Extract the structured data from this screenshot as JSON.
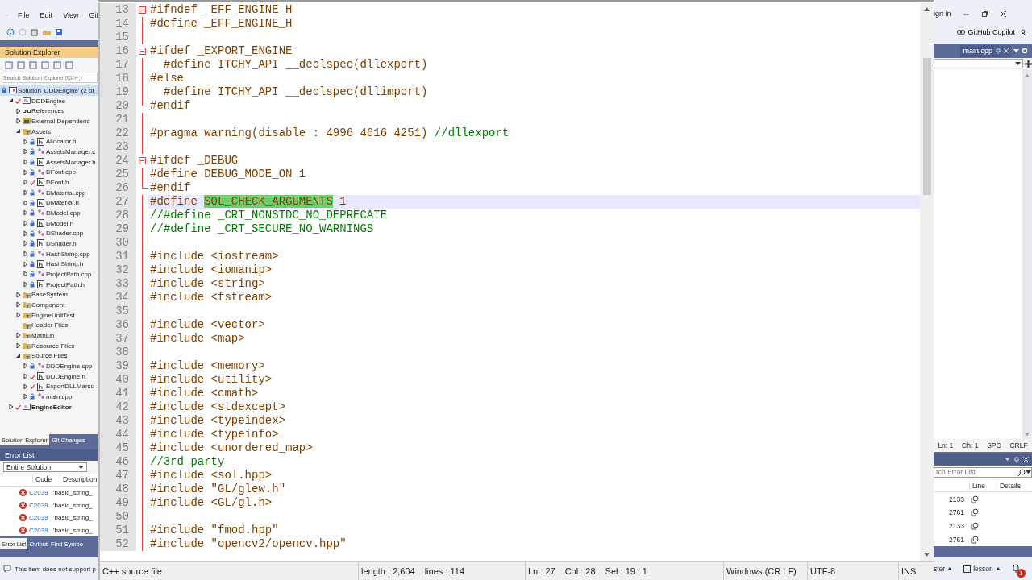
{
  "vs_menu": [
    "File",
    "Edit",
    "View",
    "Git"
  ],
  "vs_titlebar": {
    "sign_in": "ign in",
    "copilot": "GitHub Copilot"
  },
  "solution_explorer": {
    "title": "Solution Explorer",
    "search_placeholder": "Search Solution Explorer (Ctrl+;)",
    "tree": [
      {
        "label": "Solution 'DDDEngine' (2 of",
        "kind": "solution",
        "modified": false,
        "selected": true,
        "children": [
          {
            "label": "DDDEngine",
            "kind": "project",
            "modified": true,
            "expanded": true,
            "selected": false,
            "children": [
              {
                "label": "References",
                "kind": "references",
                "expanded": false,
                "selected": false
              },
              {
                "label": "External Dependenc",
                "kind": "dependencies",
                "expanded": false,
                "selected": false
              },
              {
                "label": "Assets",
                "kind": "folder",
                "expanded": true,
                "selected": false,
                "children": [
                  {
                    "label": "Allocator.h",
                    "kind": "header",
                    "modified": false,
                    "expanded": false,
                    "selected": false
                  },
                  {
                    "label": "AssetsManager.c",
                    "kind": "source",
                    "modified": false,
                    "expanded": false,
                    "selected": false
                  },
                  {
                    "label": "AssetsManager.h",
                    "kind": "header",
                    "modified": false,
                    "expanded": false,
                    "selected": false
                  },
                  {
                    "label": "DFont.cpp",
                    "kind": "source",
                    "modified": false,
                    "expanded": false,
                    "selected": false
                  },
                  {
                    "label": "DFont.h",
                    "kind": "header",
                    "modified": true,
                    "expanded": false,
                    "selected": false
                  },
                  {
                    "label": "DMaterial.cpp",
                    "kind": "source",
                    "modified": false,
                    "expanded": false,
                    "selected": false
                  },
                  {
                    "label": "DMaterial.h",
                    "kind": "header",
                    "modified": false,
                    "expanded": false,
                    "selected": false
                  },
                  {
                    "label": "DModel.cpp",
                    "kind": "source",
                    "modified": false,
                    "expanded": false,
                    "selected": false
                  },
                  {
                    "label": "DModel.h",
                    "kind": "header",
                    "modified": false,
                    "expanded": false,
                    "selected": false
                  },
                  {
                    "label": "DShader.cpp",
                    "kind": "source",
                    "modified": false,
                    "expanded": false,
                    "selected": false
                  },
                  {
                    "label": "DShader.h",
                    "kind": "header",
                    "modified": false,
                    "expanded": false,
                    "selected": false
                  },
                  {
                    "label": "HashString.cpp",
                    "kind": "source",
                    "modified": false,
                    "expanded": false,
                    "selected": false
                  },
                  {
                    "label": "HashString.h",
                    "kind": "header",
                    "modified": false,
                    "expanded": false,
                    "selected": false
                  },
                  {
                    "label": "ProjectPath.cpp",
                    "kind": "source",
                    "modified": false,
                    "expanded": false,
                    "selected": false
                  },
                  {
                    "label": "ProjectPath.h",
                    "kind": "header",
                    "modified": false,
                    "expanded": false,
                    "selected": false
                  }
                ]
              },
              {
                "label": "BaseSystem",
                "kind": "folder",
                "expanded": false,
                "selected": false
              },
              {
                "label": "Component",
                "kind": "folder",
                "expanded": false,
                "selected": false
              },
              {
                "label": "EngineUnitTest",
                "kind": "folder",
                "expanded": false,
                "selected": false
              },
              {
                "label": "Header Files",
                "kind": "folder",
                "selected": false
              },
              {
                "label": "MathLib",
                "kind": "folder",
                "expanded": false,
                "selected": false
              },
              {
                "label": "Resource Files",
                "kind": "folder",
                "expanded": false,
                "selected": false
              },
              {
                "label": "Source Files",
                "kind": "folder",
                "expanded": true,
                "selected": false,
                "children": [
                  {
                    "label": "DDDEngine.cpp",
                    "kind": "source",
                    "modified": false,
                    "expanded": false,
                    "selected": false
                  },
                  {
                    "label": "DDDEngine.h",
                    "kind": "header",
                    "modified": true,
                    "expanded": false,
                    "selected": false
                  },
                  {
                    "label": "ExportDLLMarco",
                    "kind": "header",
                    "modified": true,
                    "expanded": false,
                    "selected": false
                  },
                  {
                    "label": "main.cpp",
                    "kind": "source",
                    "modified": false,
                    "expanded": false,
                    "selected": false
                  }
                ]
              }
            ]
          },
          {
            "label": "EngineEditor",
            "kind": "project",
            "modified": true,
            "expanded": false,
            "selected": false
          }
        ]
      }
    ],
    "tabs": [
      {
        "label": "Solution Explorer",
        "selected": true
      },
      {
        "label": "Git Changes",
        "selected": false
      }
    ]
  },
  "document_tab": {
    "label": "main.cpp",
    "selected": true
  },
  "vs_editor_status": [
    "Ln: 1",
    "Ch: 1",
    "SPC",
    "CRLF"
  ],
  "error_list": {
    "title": "Error List",
    "scope": "Entire Solution",
    "search_placeholder": "rch Error List",
    "columns": [
      "Code",
      "Description",
      "Line",
      "Details"
    ],
    "rows": [
      {
        "code": "C2039",
        "description": "'basic_string_",
        "line": "2133"
      },
      {
        "code": "C2039",
        "description": "'basic_string_",
        "line": "2761"
      },
      {
        "code": "C2039",
        "description": "'basic_string_",
        "line": "2133"
      },
      {
        "code": "C2039",
        "description": "'basic_string_",
        "line": "2761"
      }
    ],
    "tabs": [
      {
        "label": "Error List",
        "selected": true
      },
      {
        "label": "Output",
        "selected": false
      },
      {
        "label": "Find Symbo",
        "selected": false
      }
    ]
  },
  "vs_status": {
    "message": "This item does not support p",
    "branch": "ster",
    "repository": "lesson",
    "notifications": "1"
  },
  "editor": {
    "lines": [
      {
        "number": "13",
        "kind": "start",
        "current": false,
        "parts": [
          {
            "text": "#ifndef _EFF_ENGINE_H",
            "kind": "pre"
          }
        ]
      },
      {
        "number": "14",
        "kind": "body",
        "current": false,
        "parts": [
          {
            "text": "#define _EFF_ENGINE_H",
            "kind": "pre"
          }
        ]
      },
      {
        "number": "15",
        "kind": "body",
        "current": false
      },
      {
        "number": "16",
        "kind": "start",
        "current": false,
        "parts": [
          {
            "text": "#ifdef _EXPORT_ENGINE",
            "kind": "pre"
          }
        ]
      },
      {
        "number": "17",
        "kind": "body",
        "current": false,
        "parts": [
          {
            "text": "  #define ITCHY_API __declspec(dllexport)",
            "kind": "pre"
          }
        ]
      },
      {
        "number": "18",
        "kind": "body",
        "current": false,
        "parts": [
          {
            "text": "#else",
            "kind": "pre"
          }
        ]
      },
      {
        "number": "19",
        "kind": "body",
        "current": false,
        "parts": [
          {
            "text": "  #define ITCHY_API __declspec(dllimport)",
            "kind": "pre"
          }
        ]
      },
      {
        "number": "20",
        "kind": "end",
        "current": false,
        "parts": [
          {
            "text": "#endif",
            "kind": "pre"
          }
        ]
      },
      {
        "number": "21",
        "kind": "body",
        "current": false
      },
      {
        "number": "22",
        "kind": "body",
        "current": false,
        "parts": [
          {
            "text": "#pragma warning(disable : 4996 4616 4251) ",
            "kind": "pre"
          },
          {
            "text": "//dllexport",
            "kind": "comment"
          }
        ]
      },
      {
        "number": "23",
        "kind": "body",
        "current": false
      },
      {
        "number": "24",
        "kind": "start",
        "current": false,
        "parts": [
          {
            "text": "#ifdef _DEBUG",
            "kind": "pre"
          }
        ]
      },
      {
        "number": "25",
        "kind": "body",
        "current": false,
        "parts": [
          {
            "text": "#define DEBUG_MODE_ON 1",
            "kind": "pre"
          }
        ]
      },
      {
        "number": "26",
        "kind": "end",
        "current": false,
        "parts": [
          {
            "text": "#endif",
            "kind": "pre"
          }
        ]
      },
      {
        "number": "27",
        "kind": "body",
        "current": true,
        "parts": [
          {
            "text": "#define ",
            "kind": "pre"
          },
          {
            "text": "SOL_CHECK_ARGUMENTS",
            "kind": "match"
          },
          {
            "text": " 1",
            "kind": "pre"
          }
        ]
      },
      {
        "number": "28",
        "kind": "body",
        "current": false,
        "parts": [
          {
            "text": "//#define _CRT_NONSTDC_NO_DEPRECATE",
            "kind": "comment"
          }
        ]
      },
      {
        "number": "29",
        "kind": "body",
        "current": false,
        "parts": [
          {
            "text": "//#define _CRT_SECURE_NO_WARNINGS",
            "kind": "comment"
          }
        ]
      },
      {
        "number": "30",
        "kind": "body",
        "current": false
      },
      {
        "number": "31",
        "kind": "body",
        "current": false,
        "parts": [
          {
            "text": "#include <iostream>",
            "kind": "pre"
          }
        ]
      },
      {
        "number": "32",
        "kind": "body",
        "current": false,
        "parts": [
          {
            "text": "#include <iomanip>",
            "kind": "pre"
          }
        ]
      },
      {
        "number": "33",
        "kind": "body",
        "current": false,
        "parts": [
          {
            "text": "#include <string>",
            "kind": "pre"
          }
        ]
      },
      {
        "number": "34",
        "kind": "body",
        "current": false,
        "parts": [
          {
            "text": "#include <fstream>",
            "kind": "pre"
          }
        ]
      },
      {
        "number": "35",
        "kind": "body",
        "current": false
      },
      {
        "number": "36",
        "kind": "body",
        "current": false,
        "parts": [
          {
            "text": "#include <vector>",
            "kind": "pre"
          }
        ]
      },
      {
        "number": "37",
        "kind": "body",
        "current": false,
        "parts": [
          {
            "text": "#include <map>",
            "kind": "pre"
          }
        ]
      },
      {
        "number": "38",
        "kind": "body",
        "current": false
      },
      {
        "number": "39",
        "kind": "body",
        "current": false,
        "parts": [
          {
            "text": "#include <memory>",
            "kind": "pre"
          }
        ]
      },
      {
        "number": "40",
        "kind": "body",
        "current": false,
        "parts": [
          {
            "text": "#include <utility>",
            "kind": "pre"
          }
        ]
      },
      {
        "number": "41",
        "kind": "body",
        "current": false,
        "parts": [
          {
            "text": "#include <cmath>",
            "kind": "pre"
          }
        ]
      },
      {
        "number": "42",
        "kind": "body",
        "current": false,
        "parts": [
          {
            "text": "#include <stdexcept>",
            "kind": "pre"
          }
        ]
      },
      {
        "number": "43",
        "kind": "body",
        "current": false,
        "parts": [
          {
            "text": "#include <typeindex>",
            "kind": "pre"
          }
        ]
      },
      {
        "number": "44",
        "kind": "body",
        "current": false,
        "parts": [
          {
            "text": "#include <typeinfo>",
            "kind": "pre"
          }
        ]
      },
      {
        "number": "45",
        "kind": "body",
        "current": false,
        "parts": [
          {
            "text": "#include <unordered_map>",
            "kind": "pre"
          }
        ]
      },
      {
        "number": "46",
        "kind": "body",
        "current": false,
        "parts": [
          {
            "text": "//3rd party",
            "kind": "comment"
          }
        ]
      },
      {
        "number": "47",
        "kind": "body",
        "current": false,
        "parts": [
          {
            "text": "#include <sol.hpp>",
            "kind": "pre"
          }
        ]
      },
      {
        "number": "48",
        "kind": "body",
        "current": false,
        "parts": [
          {
            "text": "#include \"GL/glew.h\"",
            "kind": "pre"
          }
        ]
      },
      {
        "number": "49",
        "kind": "body",
        "current": false,
        "parts": [
          {
            "text": "#include <GL/gl.h>",
            "kind": "pre"
          }
        ]
      },
      {
        "number": "50",
        "kind": "body",
        "current": false
      },
      {
        "number": "51",
        "kind": "body",
        "current": false,
        "parts": [
          {
            "text": "#include \"fmod.hpp\"",
            "kind": "pre"
          }
        ]
      },
      {
        "number": "52",
        "kind": "body",
        "current": false,
        "parts": [
          {
            "text": "#include \"opencv2/opencv.hpp\"",
            "kind": "pre"
          }
        ]
      }
    ]
  },
  "editor_status": {
    "file_type": "C++ source file",
    "length": "length : 2,604",
    "lines": "lines : 114",
    "line": "Ln : 27",
    "column": "Col : 28",
    "selection": "Sel : 19 | 1",
    "eol": "Windows (CR LF)",
    "encoding": "UTF-8",
    "mode": "INS"
  }
}
